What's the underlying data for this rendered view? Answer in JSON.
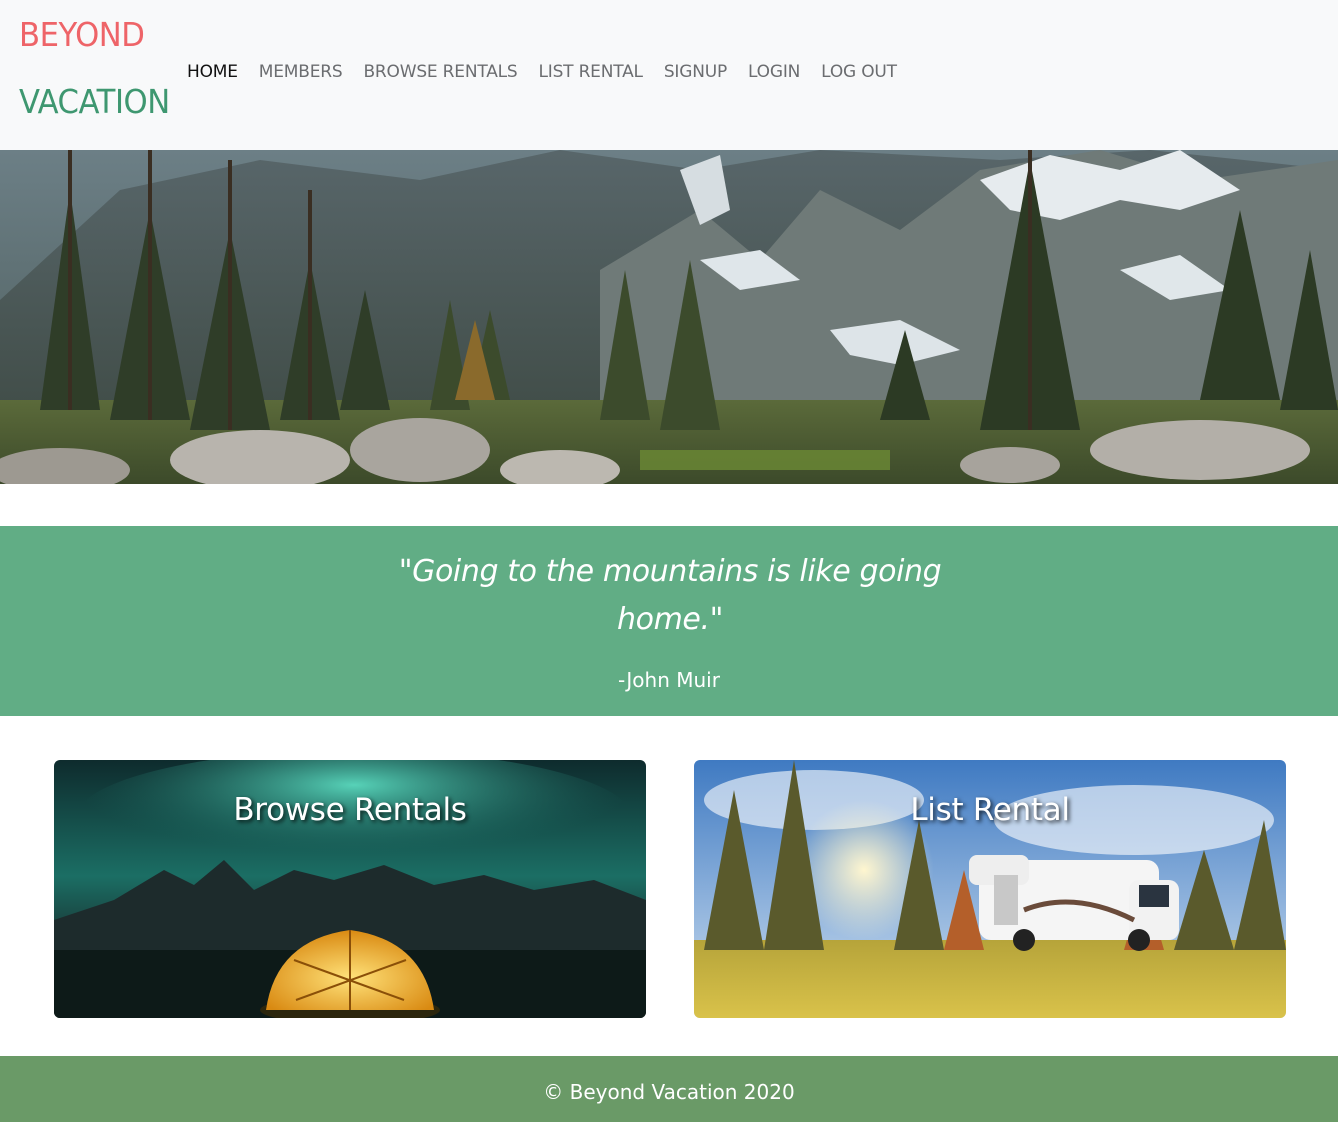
{
  "brand": {
    "line1": "BEYOND",
    "line2": "VACATION"
  },
  "nav": [
    {
      "label": "HOME",
      "active": true
    },
    {
      "label": "MEMBERS"
    },
    {
      "label": "BROWSE RENTALS"
    },
    {
      "label": "LIST RENTAL"
    },
    {
      "label": "SIGNUP"
    },
    {
      "label": "LOGIN"
    },
    {
      "label": "LOG OUT"
    }
  ],
  "hero": {
    "image": "mountain-forest-landscape"
  },
  "quote": {
    "text": "\"Going to the mountains is like going home.\"",
    "author": "-John Muir"
  },
  "cards": [
    {
      "title": "Browse Rentals",
      "image": "aurora-tent-night"
    },
    {
      "title": "List Rental",
      "image": "camper-van-forest-meadow"
    }
  ],
  "footer": {
    "text": "© Beyond Vacation 2020"
  },
  "colors": {
    "brand_red": "#ee6468",
    "brand_green": "#3e9770",
    "quote_bg": "#61ad85",
    "footer_bg": "#6a9a67",
    "navbar_bg": "#f8f9fa"
  }
}
